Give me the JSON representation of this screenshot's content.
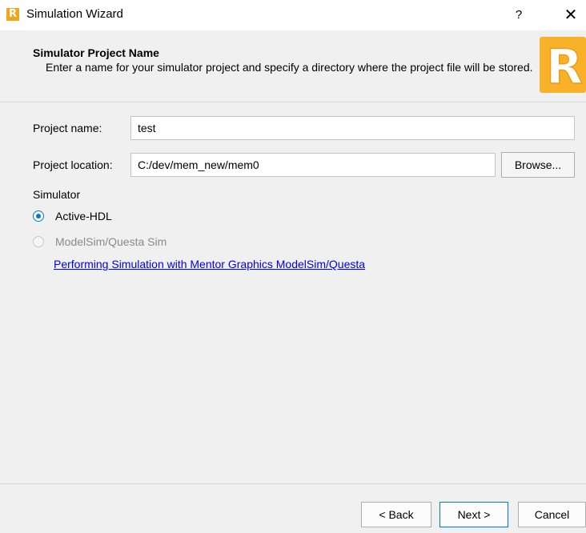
{
  "window": {
    "title": "Simulation Wizard",
    "help_glyph": "?",
    "close_glyph": "✕",
    "app_icon": "lattice-r-icon",
    "app_icon_letter": "R"
  },
  "header": {
    "title": "Simulator Project Name",
    "description": "Enter a name for your simulator project and specify a directory where the project file will be stored.",
    "logo_letter": "R"
  },
  "form": {
    "project_name_label": "Project name:",
    "project_name_value": "test",
    "project_location_label": "Project location:",
    "project_location_value": "C:/dev/mem_new/mem0",
    "browse_label": "Browse..."
  },
  "simulator": {
    "section_label": "Simulator",
    "options": [
      {
        "label": "Active-HDL",
        "checked": true,
        "disabled": false
      },
      {
        "label": "ModelSim/Questa Sim",
        "checked": false,
        "disabled": true
      }
    ],
    "help_link": "Performing Simulation with Mentor Graphics ModelSim/Questa"
  },
  "footer": {
    "back_label": "< Back",
    "next_label": "Next >",
    "cancel_label": "Cancel"
  },
  "colors": {
    "accent": "#0078d7",
    "brand": "#f5a31a",
    "link": "#0000ee"
  }
}
